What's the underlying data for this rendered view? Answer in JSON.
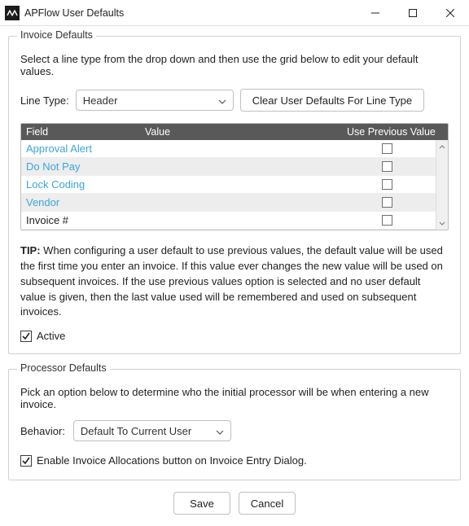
{
  "window": {
    "title": "APFlow User Defaults"
  },
  "invoice_defaults": {
    "legend": "Invoice Defaults",
    "instruction": "Select a line type from the drop down and then use the grid below to edit your default values.",
    "line_type_label": "Line Type:",
    "line_type_value": "Header",
    "clear_button": "Clear User Defaults For Line Type",
    "grid_headers": {
      "field": "Field",
      "value": "Value",
      "prev": "Use Previous Value"
    },
    "rows": [
      {
        "field": "Approval Alert",
        "link": true
      },
      {
        "field": "Do Not Pay",
        "link": true
      },
      {
        "field": "Lock Coding",
        "link": true
      },
      {
        "field": "Vendor",
        "link": true
      },
      {
        "field": "Invoice #",
        "link": false
      }
    ],
    "tip_label": "TIP:",
    "tip_text": " When configuring a user default to use previous values, the default value will be used the first time you enter an invoice. If this value ever changes the new value will be used on subsequent invoices. If the use previous values option is selected and no user default value is given, then the last value used will be remembered and used on subsequent invoices.",
    "active_label": "Active"
  },
  "processor_defaults": {
    "legend": "Processor Defaults",
    "instruction": "Pick an option below to determine who the initial processor will be when entering a new invoice.",
    "behavior_label": "Behavior:",
    "behavior_value": "Default To Current User",
    "enable_alloc_label": "Enable Invoice Allocations button on Invoice Entry Dialog."
  },
  "footer": {
    "save": "Save",
    "cancel": "Cancel"
  }
}
